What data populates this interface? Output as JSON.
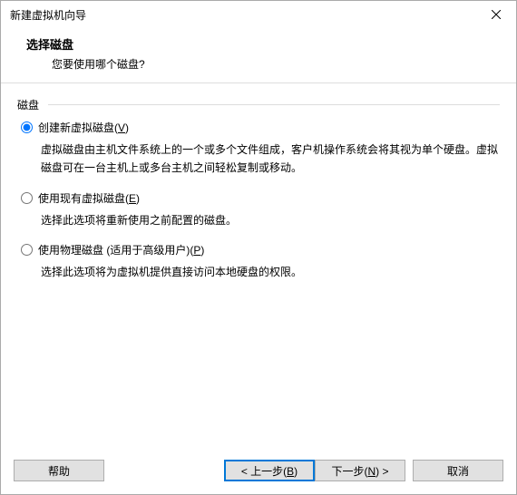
{
  "window": {
    "title": "新建虚拟机向导"
  },
  "header": {
    "title": "选择磁盘",
    "subtitle": "您要使用哪个磁盘?"
  },
  "fieldset": {
    "legend": "磁盘"
  },
  "options": [
    {
      "label_prefix": "创建新虚拟磁盘(",
      "accel": "V",
      "label_suffix": ")",
      "desc": "虚拟磁盘由主机文件系统上的一个或多个文件组成，客户机操作系统会将其视为单个硬盘。虚拟磁盘可在一台主机上或多台主机之间轻松复制或移动。",
      "checked": true
    },
    {
      "label_prefix": "使用现有虚拟磁盘(",
      "accel": "E",
      "label_suffix": ")",
      "desc": "选择此选项将重新使用之前配置的磁盘。",
      "checked": false
    },
    {
      "label_prefix": "使用物理磁盘 (适用于高级用户)(",
      "accel": "P",
      "label_suffix": ")",
      "desc": "选择此选项将为虚拟机提供直接访问本地硬盘的权限。",
      "checked": false
    }
  ],
  "buttons": {
    "help": "帮助",
    "back_prefix": "< 上一步(",
    "back_accel": "B",
    "back_suffix": ")",
    "next_prefix": "下一步(",
    "next_accel": "N",
    "next_suffix": ") >",
    "cancel": "取消"
  }
}
